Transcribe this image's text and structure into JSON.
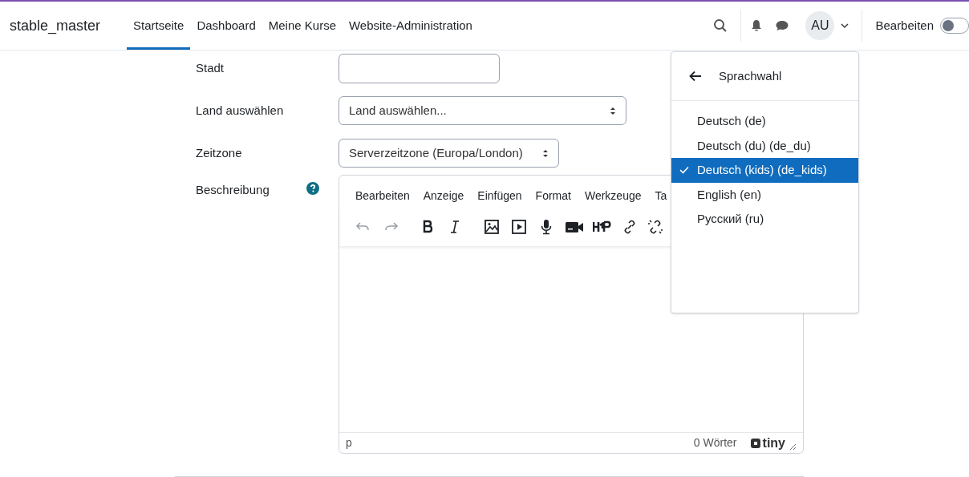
{
  "navbar": {
    "brand": "stable_master",
    "links": [
      {
        "label": "Startseite",
        "selected": true
      },
      {
        "label": "Dashboard",
        "selected": false
      },
      {
        "label": "Meine Kurse",
        "selected": false
      },
      {
        "label": "Website-Administration",
        "selected": false
      }
    ],
    "avatar": "AU",
    "edit_label": "Bearbeiten",
    "edit_on": false
  },
  "form": [
    {
      "kind": "text",
      "label": "Stadt"
    },
    {
      "kind": "select",
      "label": "Land auswählen",
      "value": "Land auswählen..."
    },
    {
      "kind": "select",
      "label": "Zeitzone",
      "value": "Serverzeitzone (Europa/London)"
    }
  ],
  "editor": {
    "label": "Beschreibung",
    "menu": [
      "Bearbeiten",
      "Anzeige",
      "Einfügen",
      "Format",
      "Werkzeuge",
      "Ta"
    ],
    "toolbar": [
      {
        "kind": "undo",
        "disabled": true
      },
      {
        "kind": "redo",
        "disabled": true
      },
      {
        "kind": "bold",
        "disabled": false
      },
      {
        "kind": "italic",
        "disabled": false
      },
      {
        "kind": "image",
        "disabled": false
      },
      {
        "kind": "media",
        "disabled": false
      },
      {
        "kind": "mic",
        "disabled": false
      },
      {
        "kind": "video",
        "disabled": false
      },
      {
        "kind": "h5p",
        "disabled": false
      },
      {
        "kind": "link",
        "disabled": false
      },
      {
        "kind": "unlink",
        "disabled": false
      }
    ],
    "path": "p",
    "word_count": "0 Wörter",
    "brand": "tiny"
  },
  "language_menu": {
    "title": "Sprachwahl",
    "items": [
      {
        "label": "Deutsch (de)",
        "selected": false
      },
      {
        "label": "Deutsch (du) (de_du)",
        "selected": false
      },
      {
        "label": "Deutsch (kids) (de_kids)",
        "selected": true
      },
      {
        "label": "English (en)",
        "selected": false
      },
      {
        "label": "Русский (ru)",
        "selected": false
      }
    ]
  }
}
